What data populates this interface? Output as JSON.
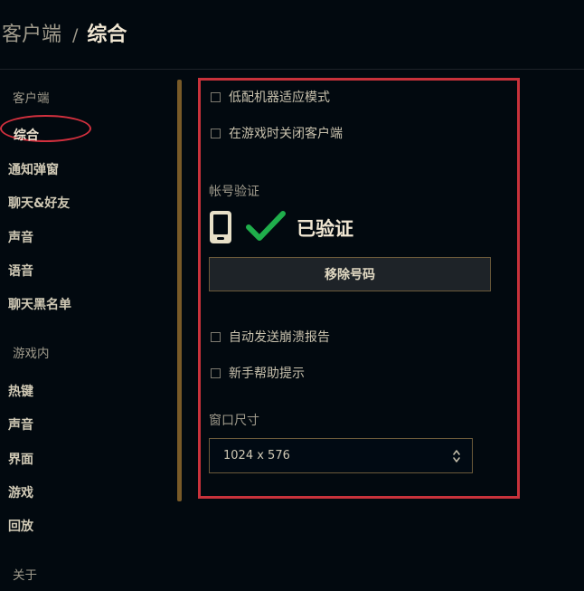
{
  "breadcrumb": {
    "parent": "客户端",
    "separator": "/",
    "current": "综合"
  },
  "sidebar": {
    "client_header": "客户端",
    "client_items": [
      "综合",
      "通知弹窗",
      "聊天&好友",
      "声音",
      "语音",
      "聊天黑名单"
    ],
    "ingame_header": "游戏内",
    "ingame_items": [
      "热键",
      "声音",
      "界面",
      "游戏",
      "回放"
    ],
    "about_header": "关于"
  },
  "settings": {
    "low_spec_mode": {
      "label": "低配机器适应模式",
      "checked": false
    },
    "close_client_in_game": {
      "label": "在游戏时关闭客户端",
      "checked": false
    },
    "account_verification_label": "帐号验证",
    "verified_status": "已验证",
    "remove_number_button": "移除号码",
    "auto_send_crash_reports": {
      "label": "自动发送崩溃报告",
      "checked": false
    },
    "newbie_tips": {
      "label": "新手帮助提示",
      "checked": false
    },
    "window_size_label": "窗口尺寸",
    "window_size_value": "1024 x 576"
  },
  "colors": {
    "highlight": "#c8323b",
    "gold": "#785a28",
    "check_green": "#1fae4b",
    "text_primary": "#f0e6d2",
    "text_muted": "#a09b8c"
  },
  "icons": [
    "phone-icon",
    "checkmark-icon",
    "select-arrows-icon"
  ]
}
